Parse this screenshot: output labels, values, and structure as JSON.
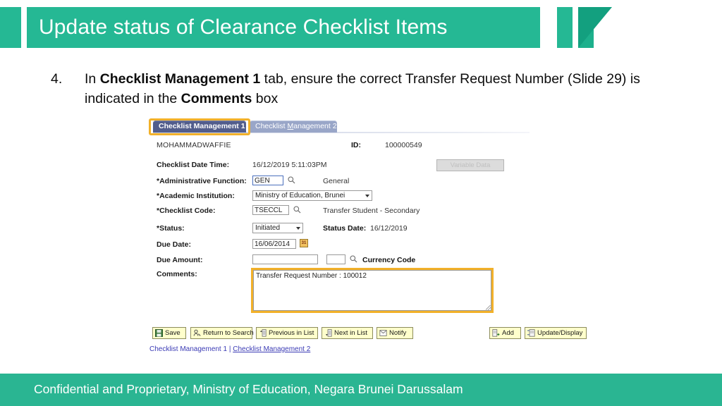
{
  "header": {
    "title": "Update status of Clearance Checklist Items",
    "accent_color": "#25b894",
    "accent_dark_color": "#13a07f"
  },
  "instruction": {
    "number": "4.",
    "part1": "In ",
    "bold1": "Checklist Management 1",
    "part2": " tab, ensure the correct Transfer Request Number (Slide 29) is indicated in the ",
    "bold2": "Comments",
    "part3": " box"
  },
  "ps": {
    "tabs": [
      {
        "label": "Checklist Management 1",
        "active": true
      },
      {
        "label": "Checklist Management 2",
        "active": false
      }
    ],
    "tab2_pre": "Checklist ",
    "tab2_accel": "M",
    "tab2_post": "anagement 2",
    "student_name": "MOHAMMADWAFFIE",
    "id_label": "ID:",
    "id_value": "100000549",
    "variable_data_button": "Variable Data",
    "fields": {
      "checklist_date_time_label": "Checklist Date Time:",
      "checklist_date_time_value": "16/12/2019  5:11:03PM",
      "administrative_function_label": "*Administrative Function:",
      "administrative_function_value": "GEN",
      "administrative_function_desc": "General",
      "academic_institution_label": "*Academic Institution:",
      "academic_institution_value": "Ministry of Education, Brunei",
      "checklist_code_label": "*Checklist Code:",
      "checklist_code_value": "TSECCL",
      "checklist_code_desc": "Transfer Student - Secondary",
      "status_label": "*Status:",
      "status_value": "Initiated",
      "status_date_label": "Status Date:",
      "status_date_value": "16/12/2019",
      "due_date_label": "Due Date:",
      "due_date_value": "16/06/2014",
      "due_amount_label": "Due Amount:",
      "due_amount_value": "",
      "currency_code_value": "",
      "currency_code_text": "Currency Code",
      "comments_label": "Comments:",
      "comments_value": "Transfer Request Number : 100012"
    },
    "calendar_icon_text": "31",
    "buttons_left": [
      {
        "label": "Save",
        "icon": "save-icon"
      },
      {
        "label": "Return to Search",
        "icon": "return-to-search-icon"
      },
      {
        "label": "Previous in List",
        "icon": "previous-in-list-icon"
      },
      {
        "label": "Next in List",
        "icon": "next-in-list-icon"
      },
      {
        "label": "Notify",
        "icon": "notify-icon"
      }
    ],
    "buttons_right": [
      {
        "label": "Add",
        "icon": "add-icon"
      },
      {
        "label": "Update/Display",
        "icon": "update-display-icon"
      }
    ],
    "footer_links": {
      "link1": "Checklist Management 1",
      "separator": " | ",
      "link2": "Checklist Management 2"
    },
    "highlight_color": "#f2b12a",
    "active_tab_color": "#525d8c"
  },
  "footer": {
    "text": "Confidential and Proprietary, Ministry of Education, Negara Brunei Darussalam",
    "color": "#2ab592"
  }
}
